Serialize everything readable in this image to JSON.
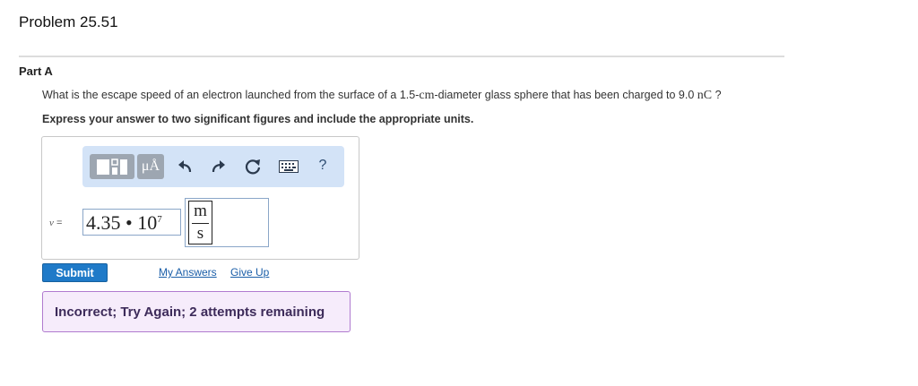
{
  "problem_title": "Problem 25.51",
  "part_label": "Part A",
  "question": {
    "prefix": "What is the escape speed of an electron launched from the surface of a 1.5-",
    "unit_cm": "cm",
    "middle": "-diameter glass sphere that has been charged to 9.0 ",
    "unit_nC": "nC",
    "suffix": " ?"
  },
  "instruction": "Express your answer to two significant figures and include the appropriate units.",
  "toolbar": {
    "units_label": "μÅ",
    "help_label": "?",
    "icons": [
      "templates-icon",
      "units-icon",
      "undo-icon",
      "redo-icon",
      "reset-icon",
      "keyboard-icon",
      "help-icon"
    ]
  },
  "answer": {
    "variable": "v",
    "equals": " =",
    "mantissa": "4.35 • 10",
    "exponent": "7",
    "unit_numerator": "m",
    "unit_denominator": "s"
  },
  "buttons": {
    "submit": "Submit",
    "my_answers": "My Answers",
    "give_up": "Give Up"
  },
  "feedback": "Incorrect; Try Again; 2 attempts remaining",
  "colors": {
    "accent": "#1f7ac8",
    "toolbar_bg": "#d3e3f7",
    "feedback_bg": "#f6ecfb",
    "feedback_border": "#b07bcf"
  }
}
